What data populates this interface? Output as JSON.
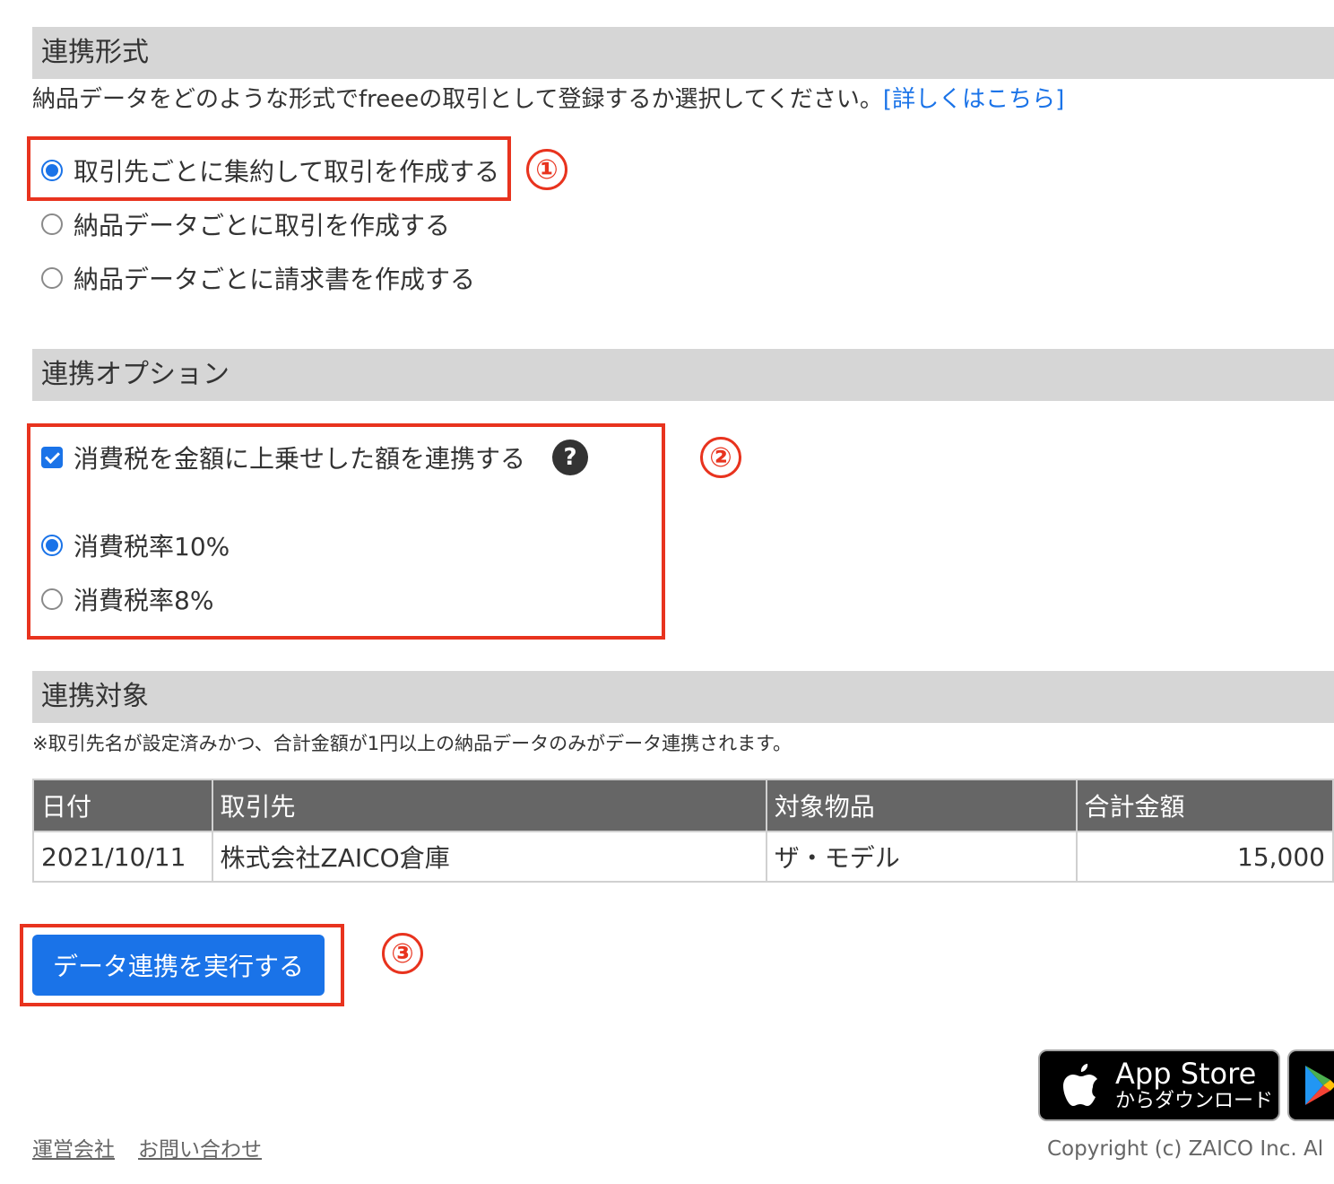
{
  "sections": {
    "format": {
      "title": "連携形式",
      "description": "納品データをどのような形式でfreeeの取引として登録するか選択してください。",
      "link_text": "[詳しくはこちら]",
      "options": [
        {
          "label": "取引先ごとに集約して取引を作成する",
          "checked": true
        },
        {
          "label": "納品データごとに取引を作成する",
          "checked": false
        },
        {
          "label": "納品データごとに請求書を作成する",
          "checked": false
        }
      ]
    },
    "options": {
      "title": "連携オプション",
      "tax_checkbox_label": "消費税を金額に上乗せした額を連携する",
      "tax_checkbox_checked": true,
      "help_icon": "?",
      "tax_rates": [
        {
          "label": "消費税率10%",
          "checked": true
        },
        {
          "label": "消費税率8%",
          "checked": false
        }
      ]
    },
    "target": {
      "title": "連携対象",
      "note": "※取引先名が設定済みかつ、合計金額が1円以上の納品データのみがデータ連携されます。",
      "table": {
        "headers": [
          "日付",
          "取引先",
          "対象物品",
          "合計金額"
        ],
        "rows": [
          [
            "2021/10/11",
            "株式会社ZAICO倉庫",
            "ザ・モデル",
            "15,000"
          ]
        ]
      }
    }
  },
  "execute_button_label": "データ連携を実行する",
  "annotations": [
    "①",
    "②",
    "③"
  ],
  "annotation_color": "#e8331e",
  "accent_color": "#1a73e8",
  "badges": {
    "app_store": {
      "line1": "App Store",
      "line2": "からダウンロード",
      "icon": "apple-icon"
    },
    "google_play": {
      "icon": "google-play-icon"
    }
  },
  "footer": {
    "links": [
      "運営会社",
      "お問い合わせ"
    ],
    "copyright": "Copyright (c) ZAICO Inc. Al"
  }
}
